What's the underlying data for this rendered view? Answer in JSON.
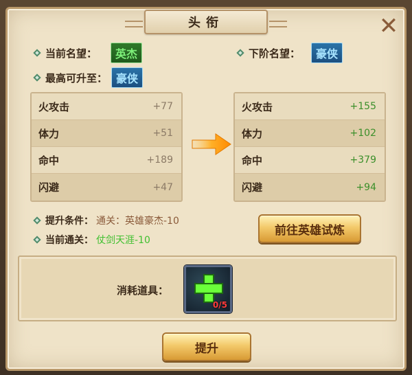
{
  "title": "头衔",
  "header": {
    "current_label": "当前名望：",
    "current_rank": "英杰",
    "next_label": "下阶名望：",
    "next_rank": "豪侠",
    "max_label": "最高可升至：",
    "max_rank": "豪侠"
  },
  "current_stats": [
    {
      "name": "火攻击",
      "value": "+77"
    },
    {
      "name": "体力",
      "value": "+51"
    },
    {
      "name": "命中",
      "value": "+189"
    },
    {
      "name": "闪避",
      "value": "+47"
    }
  ],
  "next_stats": [
    {
      "name": "火攻击",
      "value": "+155"
    },
    {
      "name": "体力",
      "value": "+102"
    },
    {
      "name": "命中",
      "value": "+379"
    },
    {
      "name": "闪避",
      "value": "+94"
    }
  ],
  "conditions": {
    "upgrade_label": "提升条件：",
    "upgrade_value": "通关：英雄豪杰-10",
    "cleared_label": "当前通关：",
    "cleared_value": "仗剑天涯-10"
  },
  "buttons": {
    "trial": "前往英雄试炼",
    "upgrade": "提升"
  },
  "consume": {
    "label": "消耗道具：",
    "count": "0/5"
  },
  "colors": {
    "panel_bg": "#efe3c8",
    "rank_green": "#7ef07a",
    "rank_blue": "#a8e4ff",
    "next_value": "#3b8f2a",
    "cleared_value": "#3fbf2f"
  }
}
